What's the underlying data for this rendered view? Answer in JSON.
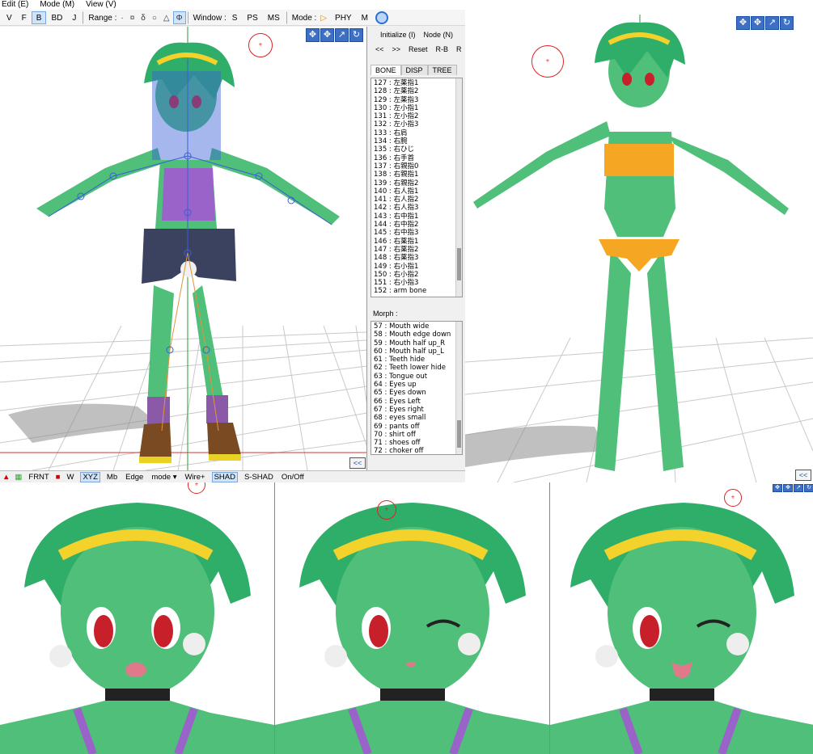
{
  "menu": [
    "Edit (E)",
    "Mode (M)",
    "View (V)"
  ],
  "toolbar": {
    "view_buttons": [
      "V",
      "F",
      "B",
      "BD",
      "J"
    ],
    "range_label": "Range :",
    "range_icons": [
      "·",
      "¤",
      "δ",
      "○",
      "△",
      "Φ"
    ],
    "window_label": "Window :",
    "window_buttons": [
      "S",
      "PS",
      "MS"
    ],
    "mode_label": "Mode :",
    "mode_buttons": [
      "▷",
      "PHY",
      "M"
    ]
  },
  "right_panel": {
    "initialize": "Initialize (I)",
    "node": "Node (N)",
    "prev": "<<",
    "next": ">>",
    "reset": "Reset",
    "rb": "R-B",
    "r": "R",
    "tabs": [
      "BONE",
      "DISP",
      "TREE"
    ],
    "bones": [
      "127 : 左薬指1",
      "128 : 左薬指2",
      "129 : 左薬指3",
      "130 : 左小指1",
      "131 : 左小指2",
      "132 : 左小指3",
      "133 : 右肩",
      "134 : 右腕",
      "135 : 右ひじ",
      "136 : 右手首",
      "137 : 右親指0",
      "138 : 右親指1",
      "139 : 右親指2",
      "140 : 右人指1",
      "141 : 右人指2",
      "142 : 右人指3",
      "143 : 右中指1",
      "144 : 右中指2",
      "145 : 右中指3",
      "146 : 右薬指1",
      "147 : 右薬指2",
      "148 : 右薬指3",
      "149 : 右小指1",
      "150 : 右小指2",
      "151 : 右小指3",
      "152 : arm bone"
    ],
    "morph_label": "Morph :",
    "morphs": [
      "57 : Mouth wide",
      "58 : Mouth edge down",
      "59 : Mouth half up_R",
      "60 : Mouth half up_L",
      "61 : Teeth hide",
      "62 : Teeth lower hide",
      "63 : Tongue out",
      "64 : Eyes up",
      "65 : Eyes down",
      "66 : Eyes Left",
      "67 : Eyes right",
      "68 : eyes small",
      "69 : pants off",
      "70 : shirt off",
      "71 : shoes off",
      "72 : choker off"
    ],
    "collapse": "<<"
  },
  "statusbar": {
    "items": [
      "FRNT",
      "W",
      "XYZ",
      "Mb",
      "Edge",
      "mode ▾",
      "Wire+",
      "SHAD",
      "S-SHAD",
      "On/Off"
    ]
  },
  "view_tools": [
    "✥",
    "✥",
    "↗",
    "↻"
  ],
  "colors": {
    "skin": "#4fbf7a",
    "skin_dark": "#2f9a5a",
    "hair": "#2fae6a",
    "hair_dark": "#1f7f4c",
    "headband": "#f3d22b",
    "top_purple": "#9a63c9",
    "top_orange": "#f5a623",
    "shorts": "#3b4260",
    "bone_blue": "#3a5fd6",
    "eye_red": "#c8202a",
    "accent_blue": "#3d6fc4",
    "cursor_red": "#d22222"
  }
}
